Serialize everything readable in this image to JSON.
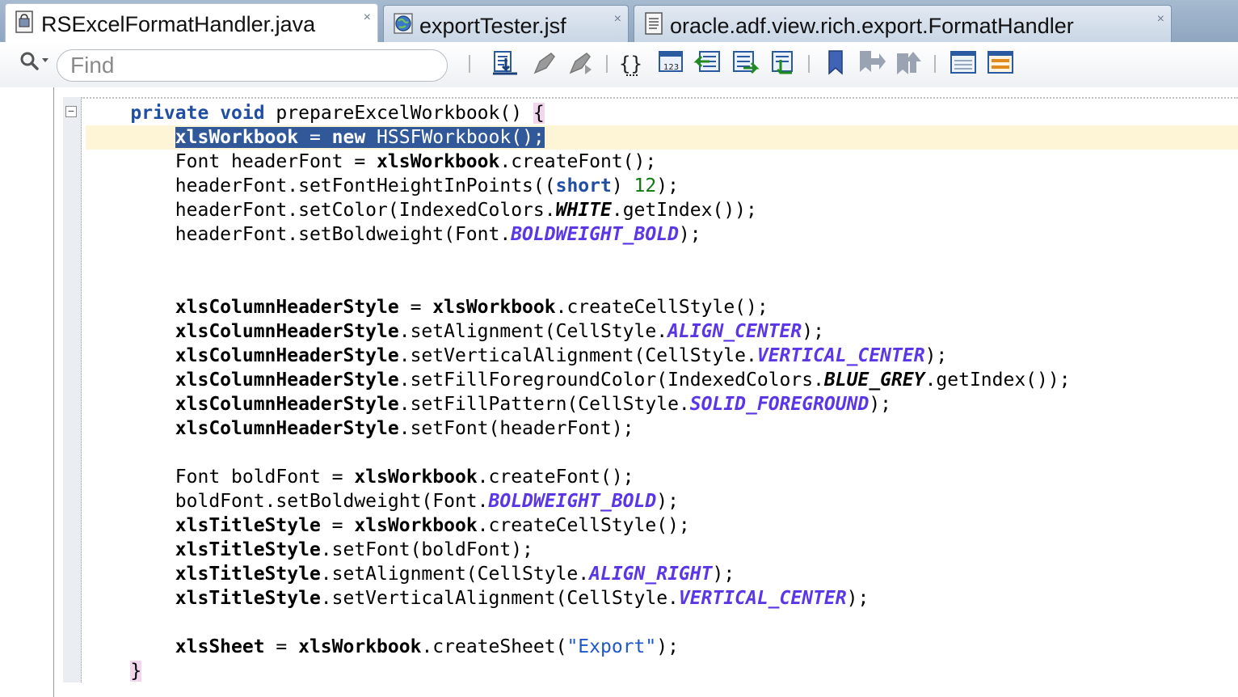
{
  "tabs": [
    {
      "label": "RSExcelFormatHandler.java",
      "icon": "java-class-icon",
      "active": true
    },
    {
      "label": "exportTester.jsf",
      "icon": "globe-icon",
      "active": false
    },
    {
      "label": "oracle.adf.view.rich.export.FormatHandler",
      "icon": "document-icon",
      "active": false
    }
  ],
  "tab_close_glyph": "×",
  "search": {
    "placeholder": "Find",
    "value": ""
  },
  "toolbar_icons": [
    "find-usages-icon",
    "previous-edit-icon",
    "next-edit-icon",
    "toggle-braces-icon",
    "toggle-line-numbers-icon",
    "shift-left-icon",
    "shift-right-icon",
    "toggle-comment-icon",
    "toggle-bookmark-icon",
    "previous-bookmark-icon",
    "next-bookmark-icon",
    "split-view-icon",
    "toggle-structure-icon"
  ],
  "code": {
    "fold_glyph": "−",
    "line1": {
      "t1": "    ",
      "kw1": "private",
      "t2": " ",
      "kw2": "void",
      "t3": " prepareExcelWorkbook() ",
      "brace": "{"
    },
    "line2": {
      "indent": "        ",
      "t1": "xlsWorkbook",
      "t2": " = ",
      "kw": "new",
      "t3": " HSSFWorkbook();"
    },
    "line3": {
      "indent": "        ",
      "t1": "Font headerFont = ",
      "b1": "xlsWorkbook",
      "t2": ".createFont();"
    },
    "line4": {
      "indent": "        ",
      "t1": "headerFont.setFontHeightInPoints((",
      "kw": "short",
      "t2": ") ",
      "num": "12",
      "t3": ");"
    },
    "line5": {
      "indent": "        ",
      "t1": "headerFont.setColor(IndexedColors.",
      "c1": "WHITE",
      "t2": ".getIndex());"
    },
    "line6": {
      "indent": "        ",
      "t1": "headerFont.setBoldweight(Font.",
      "c1": "BOLDWEIGHT_BOLD",
      "t2": ");"
    },
    "line7": {
      "indent": "        ",
      "b1": "xlsColumnHeaderStyle",
      "t1": " = ",
      "b2": "xlsWorkbook",
      "t2": ".createCellStyle();"
    },
    "line8": {
      "indent": "        ",
      "b1": "xlsColumnHeaderStyle",
      "t1": ".setAlignment(CellStyle.",
      "c1": "ALIGN_CENTER",
      "t2": ");"
    },
    "line9": {
      "indent": "        ",
      "b1": "xlsColumnHeaderStyle",
      "t1": ".setVerticalAlignment(CellStyle.",
      "c1": "VERTICAL_CENTER",
      "t2": ");"
    },
    "line10": {
      "indent": "        ",
      "b1": "xlsColumnHeaderStyle",
      "t1": ".setFillForegroundColor(IndexedColors.",
      "c1": "BLUE_GREY",
      "t2": ".getIndex());"
    },
    "line11": {
      "indent": "        ",
      "b1": "xlsColumnHeaderStyle",
      "t1": ".setFillPattern(CellStyle.",
      "c1": "SOLID_FOREGROUND",
      "t2": ");"
    },
    "line12": {
      "indent": "        ",
      "b1": "xlsColumnHeaderStyle",
      "t1": ".setFont(headerFont);"
    },
    "line13": {
      "indent": "        ",
      "t1": "Font boldFont = ",
      "b1": "xlsWorkbook",
      "t2": ".createFont();"
    },
    "line14": {
      "indent": "        ",
      "t1": "boldFont.setBoldweight(Font.",
      "c1": "BOLDWEIGHT_BOLD",
      "t2": ");"
    },
    "line15": {
      "indent": "        ",
      "b1": "xlsTitleStyle",
      "t1": " = ",
      "b2": "xlsWorkbook",
      "t2": ".createCellStyle();"
    },
    "line16": {
      "indent": "        ",
      "b1": "xlsTitleStyle",
      "t1": ".setFont(boldFont);"
    },
    "line17": {
      "indent": "        ",
      "b1": "xlsTitleStyle",
      "t1": ".setAlignment(CellStyle.",
      "c1": "ALIGN_RIGHT",
      "t2": ");"
    },
    "line18": {
      "indent": "        ",
      "b1": "xlsTitleStyle",
      "t1": ".setVerticalAlignment(CellStyle.",
      "c1": "VERTICAL_CENTER",
      "t2": ");"
    },
    "line19": {
      "indent": "        ",
      "b1": "xlsSheet",
      "t1": " = ",
      "b2": "xlsWorkbook",
      "t2": ".createSheet(",
      "str": "\"Export\"",
      "t3": ");"
    },
    "line20": {
      "indent": "    ",
      "brace": "}"
    }
  }
}
